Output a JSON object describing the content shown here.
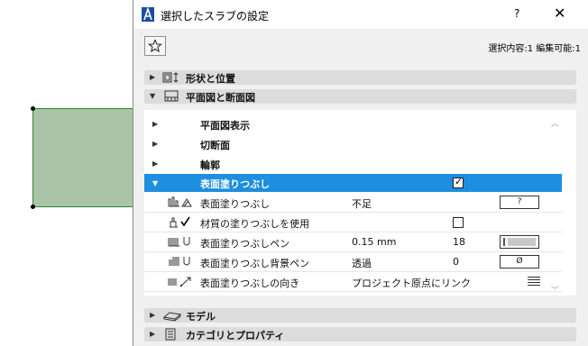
{
  "dialog": {
    "title": "選択したスラブの設定",
    "help": "?",
    "close": "✕",
    "selection_info": "選択内容:1 編集可能:1"
  },
  "sections": {
    "shape": "形状と位置",
    "plan": "平面図と断面図",
    "model": "モデル",
    "category": "カテゴリとプロパティ"
  },
  "groups": {
    "floorplan": "平面図表示",
    "cut": "切断面",
    "outline": "輪郭",
    "cover_fill": "表面塗りつぶし"
  },
  "props": [
    {
      "label": "表面塗りつぶし",
      "value": "不足",
      "button": "?"
    },
    {
      "label": "材質の塗りつぶしを使用"
    },
    {
      "label": "表面塗りつぶしペン",
      "value": "0.15 mm",
      "num": "18"
    },
    {
      "label": "表面塗りつぶし背景ペン",
      "value": "透過",
      "num": "0",
      "button": "Ø"
    },
    {
      "label": "表面塗りつぶしの向き",
      "value": "プロジェクト原点にリンク"
    }
  ],
  "colors": {
    "selection": "#1e8ede",
    "slab_fill": "#a9c4a6",
    "slab_border": "#2e8a2e"
  },
  "icons": {
    "favorites": "star-icon",
    "app": "archicad-icon"
  }
}
